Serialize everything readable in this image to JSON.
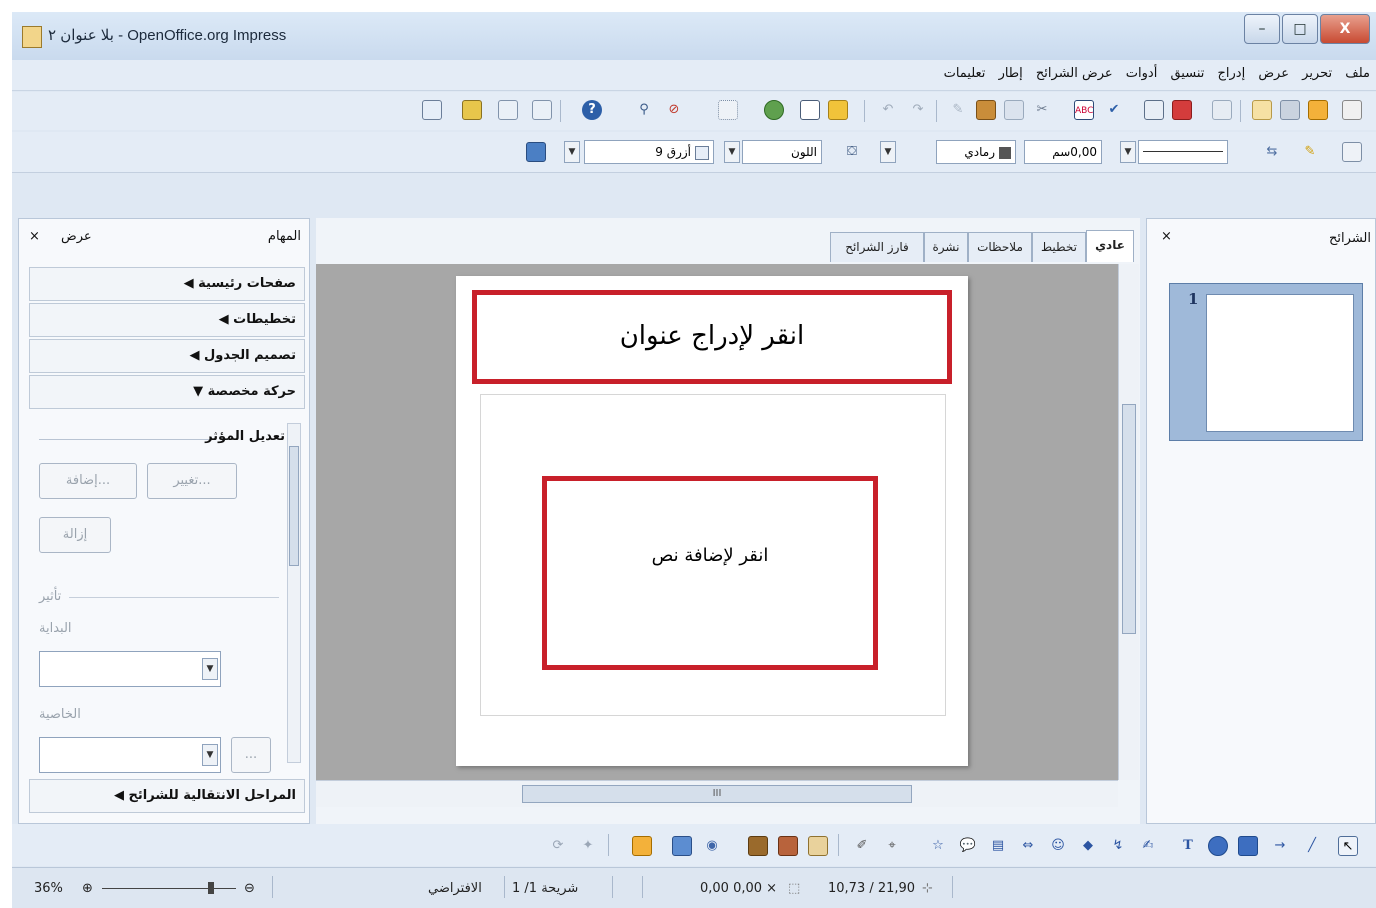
{
  "window": {
    "title": "بلا عنوان ٢ - OpenOffice.org Impress",
    "controls": {
      "minimize": "–",
      "maximize": "□",
      "close": "X"
    }
  },
  "menu": {
    "items": [
      "ملف",
      "تحرير",
      "عرض",
      "إدراج",
      "تنسيق",
      "أدوات",
      "عرض الشرائح",
      "إطار",
      "تعليمات"
    ]
  },
  "line_toolbar": {
    "line_color_value": "رمادي",
    "line_width_value": "0,00سم",
    "area_style_value": "اللون",
    "area_color_value": "أزرق 9"
  },
  "tasks_panel": {
    "title": "المهام",
    "view_label": "عرض",
    "close": "×",
    "sections": [
      {
        "label": "صفحات رئيسية",
        "arrow": "◀"
      },
      {
        "label": "تخطيطات",
        "arrow": "◀"
      },
      {
        "label": "تصميم الجدول",
        "arrow": "◀"
      },
      {
        "label": "حركة مخصصة",
        "arrow": "▼"
      }
    ],
    "modify_effect_label": "تعديل المؤثر",
    "add_button": "إضافة...",
    "change_button": "تغيير...",
    "remove_button": "إزالة",
    "effect_group_label": "تأثير",
    "start_label": "البداية",
    "property_label": "الخاصية",
    "ellipsis_button": "...",
    "transition_section": "المراحل الانتقالية للشرائح",
    "transition_arrow": "◀"
  },
  "view_tabs": [
    "عادي",
    "تخطيط",
    "ملاحظات",
    "نشرة",
    "فارز الشرائح"
  ],
  "slide": {
    "title_placeholder": "انقر لإدراج عنوان",
    "body_placeholder": "انقر لإضافة نص"
  },
  "slides_panel": {
    "title": "الشرائح",
    "close": "×",
    "thumbnails": [
      {
        "number": "1"
      }
    ]
  },
  "hscroll": {
    "mark": "III"
  },
  "status": {
    "zoom": "36%",
    "zoom_minus": "⊖",
    "zoom_plus": "⊕",
    "slide_info": "شريحة 1/ 1",
    "master": "الافتراضي",
    "position": "0,00 0,00 ×",
    "size": "10,73 / 21,90"
  },
  "colors": {
    "highlight_red": "#c8202a",
    "window_bg": "#dfe8f3",
    "workspace_gray": "#a7a7a7",
    "thumbnail_blue": "#9fb9d9"
  }
}
